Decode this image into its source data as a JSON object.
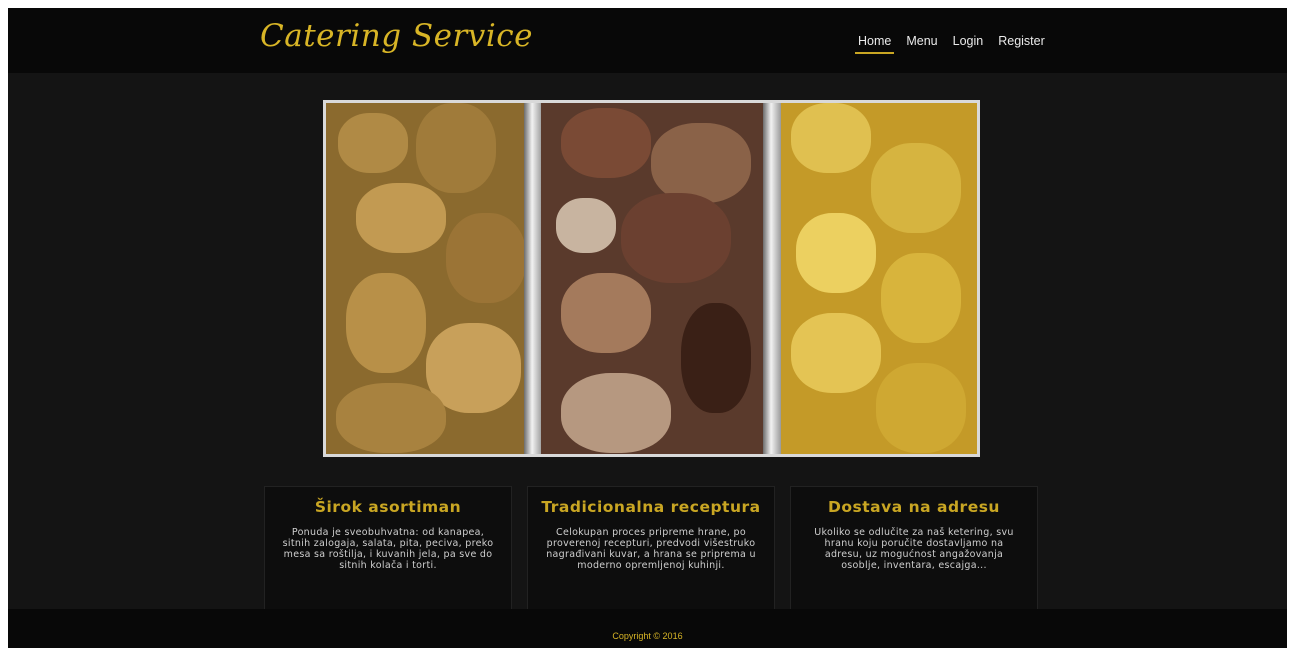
{
  "brand": {
    "name": "Catering Service"
  },
  "nav": {
    "items": [
      {
        "label": "Home",
        "active": true
      },
      {
        "label": "Menu",
        "active": false
      },
      {
        "label": "Login",
        "active": false
      },
      {
        "label": "Register",
        "active": false
      }
    ]
  },
  "features": [
    {
      "title": "Širok asortiman",
      "text": "Ponuda je sveobuhvatna: od kanapea, sitnih zalogaja, salata, pita, peciva, preko mesa sa roštilja, i kuvanih jela, pa sve do sitnih kolača i torti."
    },
    {
      "title": "Tradicionalna receptura",
      "text": "Celokupan proces pripreme hrane, po proverenoj recepturi, predvodi višestruko nagrađivani kuvar, a hrana se priprema u moderno opremljenoj kuhinji."
    },
    {
      "title": "Dostava na adresu",
      "text": "Ukoliko se odlučite za naš ketering, svu hranu koju poručite dostavljamo na adresu, uz mogućnost angažovanja osoblje, inventara, escajga..."
    }
  ],
  "footer": {
    "copyright": "Copyright © 2016"
  },
  "colors": {
    "accent": "#c9a623",
    "background": "#141414",
    "bar": "#080808"
  }
}
